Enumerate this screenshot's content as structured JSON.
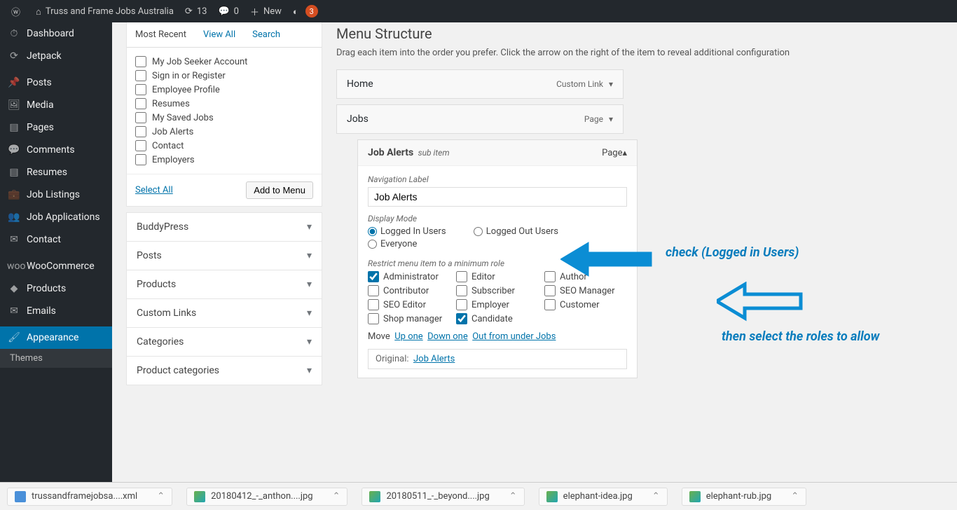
{
  "toolbar": {
    "site_name": "Truss and Frame Jobs Australia",
    "updates": "13",
    "comments": "0",
    "new": "New",
    "yoast_badge": "3"
  },
  "sidebar": {
    "items": [
      {
        "icon": "⏱",
        "label": "Dashboard"
      },
      {
        "icon": "⟳",
        "label": "Jetpack"
      },
      {
        "icon": "📌",
        "label": "Posts"
      },
      {
        "icon": "🖼",
        "label": "Media"
      },
      {
        "icon": "▤",
        "label": "Pages"
      },
      {
        "icon": "💬",
        "label": "Comments"
      },
      {
        "icon": "▤",
        "label": "Resumes"
      },
      {
        "icon": "💼",
        "label": "Job Listings"
      },
      {
        "icon": "👥",
        "label": "Job Applications"
      },
      {
        "icon": "✉",
        "label": "Contact"
      },
      {
        "icon": "woo",
        "label": "WooCommerce"
      },
      {
        "icon": "◆",
        "label": "Products"
      },
      {
        "icon": "✉",
        "label": "Emails"
      },
      {
        "icon": "🖌",
        "label": "Appearance",
        "current": true
      }
    ],
    "sub": "Themes"
  },
  "pages_box": {
    "tabs": [
      "Most Recent",
      "View All",
      "Search"
    ],
    "items": [
      "My Job Seeker Account",
      "Sign in or Register",
      "Employee Profile",
      "Resumes",
      "My Saved Jobs",
      "Job Alerts",
      "Contact",
      "Employers"
    ],
    "select_all": "Select All",
    "add_to_menu": "Add to Menu"
  },
  "accordions": [
    "BuddyPress",
    "Posts",
    "Products",
    "Custom Links",
    "Categories",
    "Product categories"
  ],
  "structure": {
    "title": "Menu Structure",
    "desc": "Drag each item into the order you prefer. Click the arrow on the right of the item to reveal additional configuration",
    "items": [
      {
        "title": "Home",
        "type": "Custom Link"
      },
      {
        "title": "Jobs",
        "type": "Page"
      }
    ],
    "sub_item": {
      "title": "Job Alerts",
      "subtitle": "sub item",
      "type": "Page",
      "nav_label": "Navigation Label",
      "nav_value": "Job Alerts",
      "display_mode_label": "Display Mode",
      "display_modes": [
        "Logged In Users",
        "Logged Out Users",
        "Everyone"
      ],
      "restrict_label": "Restrict menu item to a minimum role",
      "roles": [
        {
          "label": "Administrator",
          "checked": true
        },
        {
          "label": "Editor",
          "checked": false
        },
        {
          "label": "Author",
          "checked": false
        },
        {
          "label": "Contributor",
          "checked": false
        },
        {
          "label": "Subscriber",
          "checked": false
        },
        {
          "label": "SEO Manager",
          "checked": false
        },
        {
          "label": "SEO Editor",
          "checked": false
        },
        {
          "label": "Employer",
          "checked": false
        },
        {
          "label": "Customer",
          "checked": false
        },
        {
          "label": "Shop manager",
          "checked": false
        },
        {
          "label": "Candidate",
          "checked": true
        }
      ],
      "move_label": "Move",
      "move_links": [
        "Up one",
        "Down one",
        "Out from under Jobs"
      ],
      "original_label": "Original:",
      "original_link": "Job Alerts"
    }
  },
  "annotations": {
    "a1": "check (Logged in Users)",
    "a2": "then select the roles to allow"
  },
  "downloads": [
    {
      "name": "trussandframejobsa....xml",
      "kind": "xml"
    },
    {
      "name": "20180412_-_anthon....jpg",
      "kind": "img"
    },
    {
      "name": "20180511_-_beyond....jpg",
      "kind": "img"
    },
    {
      "name": "elephant-idea.jpg",
      "kind": "img"
    },
    {
      "name": "elephant-rub.jpg",
      "kind": "img"
    }
  ]
}
